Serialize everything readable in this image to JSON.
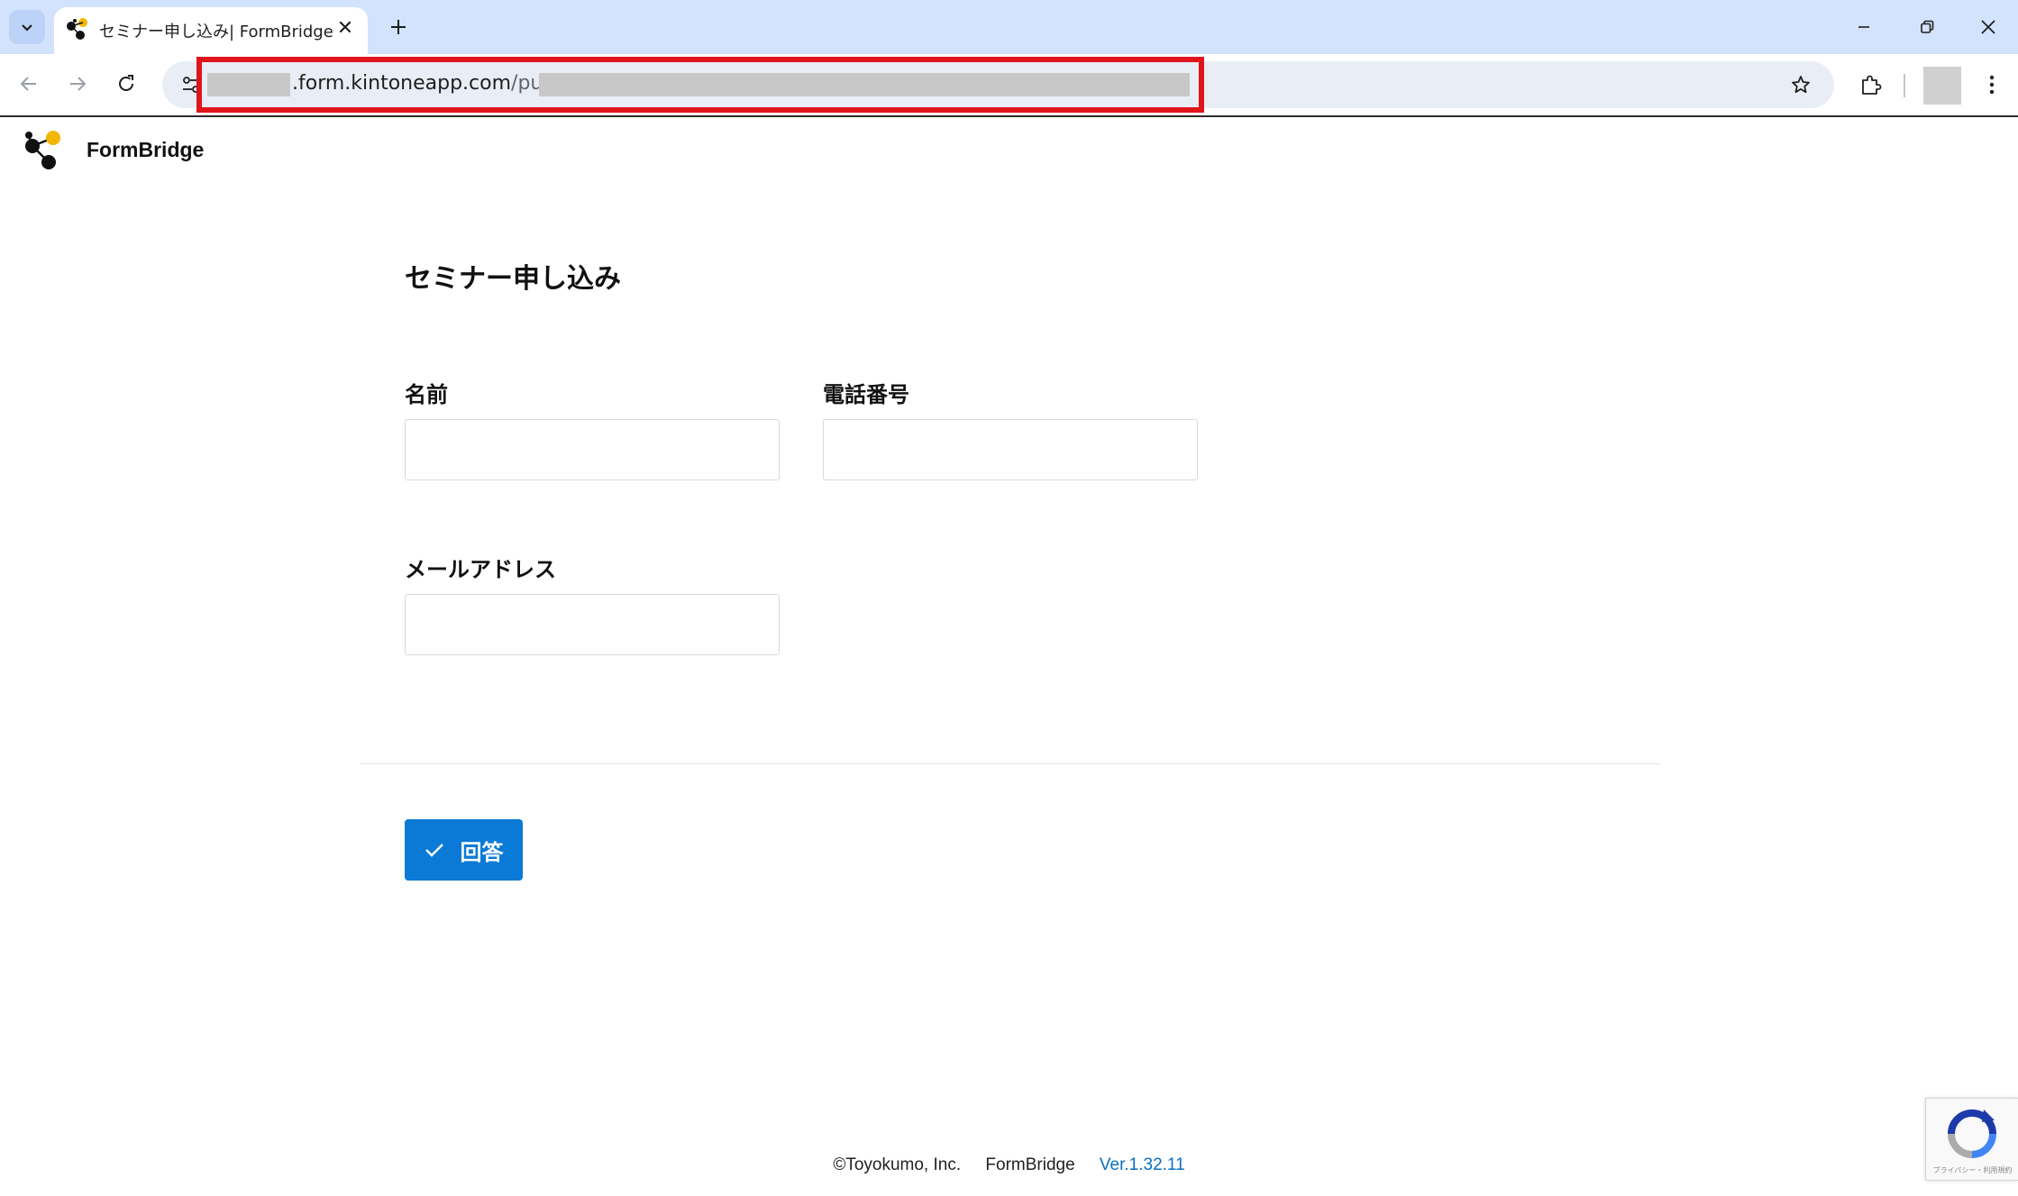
{
  "browser": {
    "tab_title": "セミナー申し込み| FormBridge",
    "url_host_suffix": ".form.kintoneapp.com",
    "url_path": "/public/",
    "icons": {
      "tab_list": "chevron-down-icon",
      "new_tab": "plus-icon",
      "back": "arrow-left-icon",
      "forward": "arrow-right-icon",
      "reload": "reload-icon",
      "site_info": "tune-icon",
      "bookmark": "star-icon",
      "extensions": "puzzle-icon",
      "menu": "kebab-icon"
    },
    "colors": {
      "titlebar": "#d3e3fd",
      "omnibox": "#e9eef6",
      "highlight": "#e0141c"
    }
  },
  "app": {
    "brand_name": "FormBridge",
    "logo_colors": {
      "dot_accent": "#f2b705",
      "dot_main": "#111111"
    }
  },
  "form": {
    "title": "セミナー申し込み",
    "fields": {
      "name": {
        "label": "名前",
        "value": ""
      },
      "phone": {
        "label": "電話番号",
        "value": ""
      },
      "email": {
        "label": "メールアドレス",
        "value": ""
      }
    },
    "submit_label": "回答",
    "submit_color": "#0a7ad6"
  },
  "footer": {
    "copyright": "©Toyokumo, Inc.",
    "product": "FormBridge",
    "version": "Ver.1.32.11"
  },
  "recaptcha": {
    "text": "プライバシー・利用規約"
  }
}
